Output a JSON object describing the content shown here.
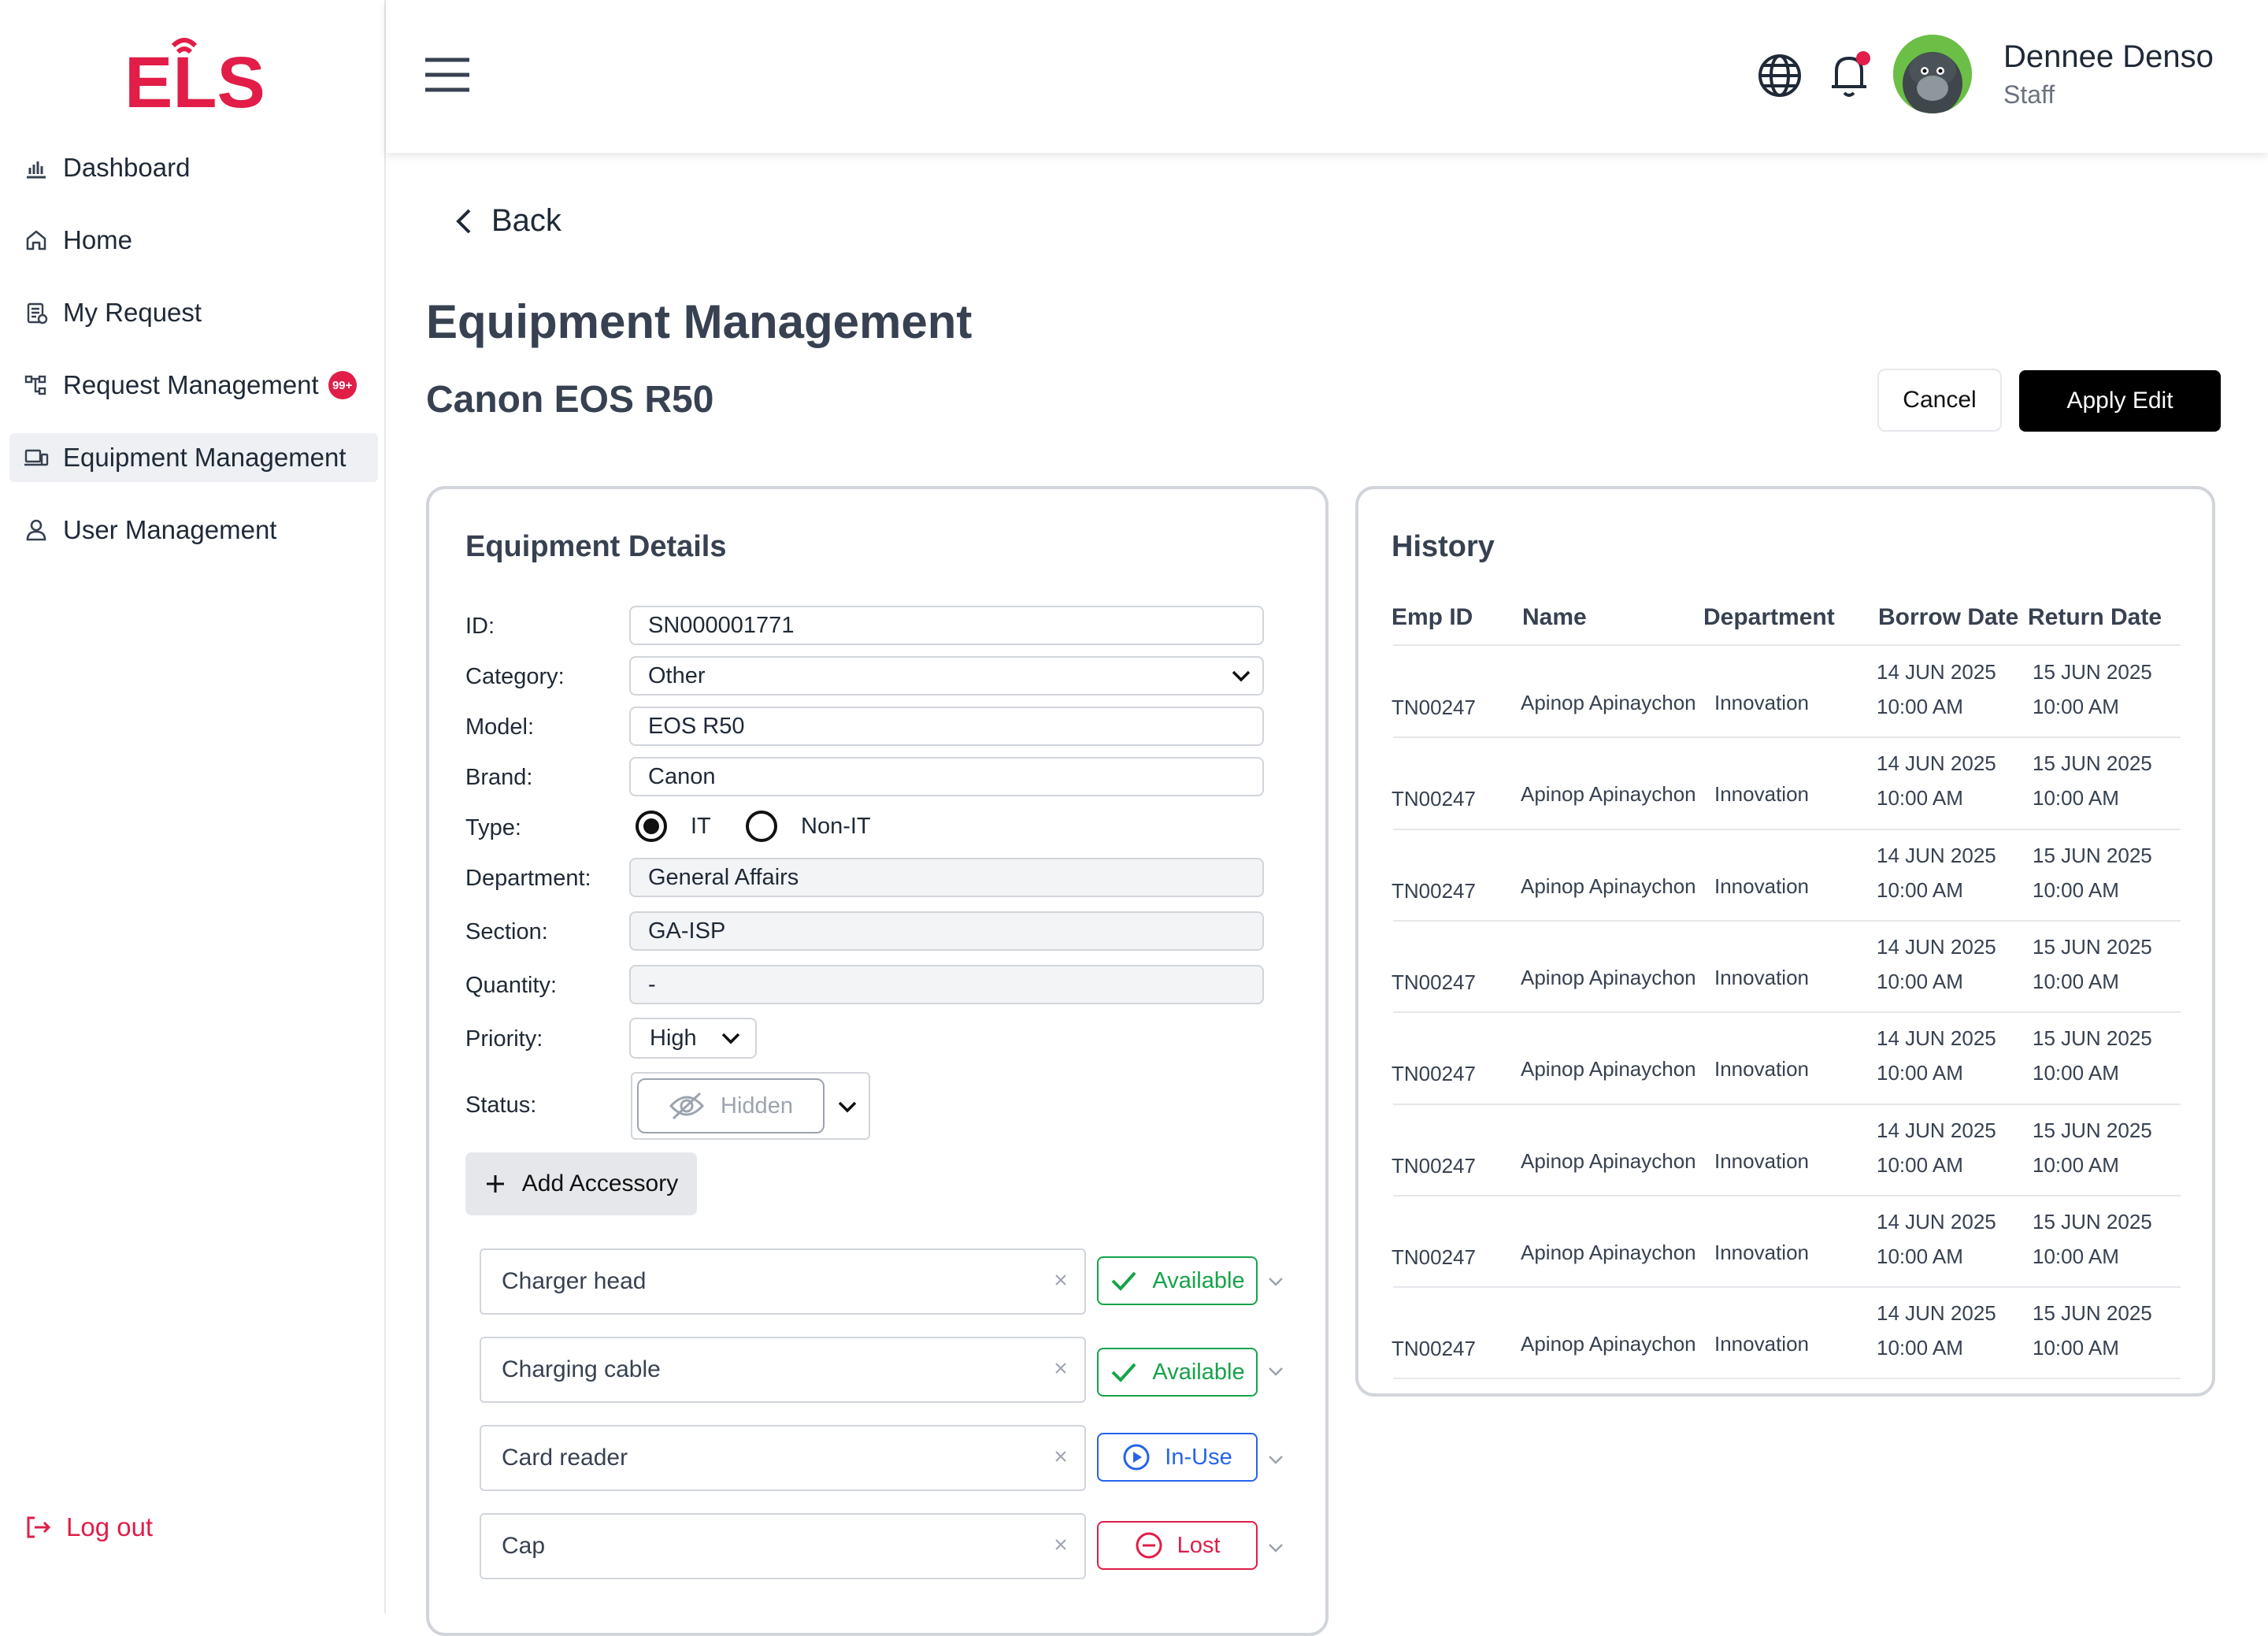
{
  "brand": {
    "logo_text": "ELS",
    "color": "#e11d48"
  },
  "sidebar": {
    "items": [
      {
        "label": "Dashboard",
        "icon": "bar-chart-icon"
      },
      {
        "label": "Home",
        "icon": "home-icon"
      },
      {
        "label": "My Request",
        "icon": "clipboard-icon"
      },
      {
        "label": "Request Management",
        "icon": "hierarchy-icon",
        "badge": "99+"
      },
      {
        "label": "Equipment Management",
        "icon": "devices-icon",
        "active": true
      },
      {
        "label": "User Management",
        "icon": "user-icon"
      }
    ],
    "logout": "Log out"
  },
  "header": {
    "user_name": "Dennee Denso",
    "user_role": "Staff"
  },
  "page": {
    "back": "Back",
    "title": "Equipment Management",
    "subtitle": "Canon EOS R50",
    "cancel": "Cancel",
    "apply": "Apply Edit"
  },
  "details": {
    "title": "Equipment Details",
    "fields": {
      "id_label": "ID:",
      "id": "SN000001771",
      "category_label": "Category:",
      "category": "Other",
      "model_label": "Model:",
      "model": "EOS R50",
      "brand_label": "Brand:",
      "brand": "Canon",
      "type_label": "Type:",
      "type_it": "IT",
      "type_nonit": "Non-IT",
      "department_label": "Department:",
      "department": "General Affairs",
      "section_label": "Section:",
      "section": "GA-ISP",
      "quantity_label": "Quantity:",
      "quantity": "-",
      "priority_label": "Priority:",
      "priority": "High",
      "status_label": "Status:",
      "status": "Hidden"
    },
    "add_accessory": "Add Accessory",
    "accessories": [
      {
        "name": "Charger head",
        "status": "Available"
      },
      {
        "name": "Charging cable",
        "status": "Available"
      },
      {
        "name": "Card reader",
        "status": "In-Use"
      },
      {
        "name": "Cap",
        "status": "Lost"
      }
    ]
  },
  "history": {
    "title": "History",
    "columns": [
      "Emp ID",
      "Name",
      "Department",
      "Borrow Date",
      "Return Date"
    ],
    "rows": [
      {
        "emp": "TN00247",
        "name": "Apinop Apinaychon",
        "dept": "Innovation",
        "borrow_d": "14 JUN 2025",
        "borrow_t": "10:00 AM",
        "return_d": "15 JUN 2025",
        "return_t": "10:00 AM"
      },
      {
        "emp": "TN00247",
        "name": "Apinop Apinaychon",
        "dept": "Innovation",
        "borrow_d": "14 JUN 2025",
        "borrow_t": "10:00 AM",
        "return_d": "15 JUN 2025",
        "return_t": "10:00 AM"
      },
      {
        "emp": "TN00247",
        "name": "Apinop Apinaychon",
        "dept": "Innovation",
        "borrow_d": "14 JUN 2025",
        "borrow_t": "10:00 AM",
        "return_d": "15 JUN 2025",
        "return_t": "10:00 AM"
      },
      {
        "emp": "TN00247",
        "name": "Apinop Apinaychon",
        "dept": "Innovation",
        "borrow_d": "14 JUN 2025",
        "borrow_t": "10:00 AM",
        "return_d": "15 JUN 2025",
        "return_t": "10:00 AM"
      },
      {
        "emp": "TN00247",
        "name": "Apinop Apinaychon",
        "dept": "Innovation",
        "borrow_d": "14 JUN 2025",
        "borrow_t": "10:00 AM",
        "return_d": "15 JUN 2025",
        "return_t": "10:00 AM"
      },
      {
        "emp": "TN00247",
        "name": "Apinop Apinaychon",
        "dept": "Innovation",
        "borrow_d": "14 JUN 2025",
        "borrow_t": "10:00 AM",
        "return_d": "15 JUN 2025",
        "return_t": "10:00 AM"
      },
      {
        "emp": "TN00247",
        "name": "Apinop Apinaychon",
        "dept": "Innovation",
        "borrow_d": "14 JUN 2025",
        "borrow_t": "10:00 AM",
        "return_d": "15 JUN 2025",
        "return_t": "10:00 AM"
      },
      {
        "emp": "TN00247",
        "name": "Apinop Apinaychon",
        "dept": "Innovation",
        "borrow_d": "14 JUN 2025",
        "borrow_t": "10:00 AM",
        "return_d": "15 JUN 2025",
        "return_t": "10:00 AM"
      }
    ]
  }
}
